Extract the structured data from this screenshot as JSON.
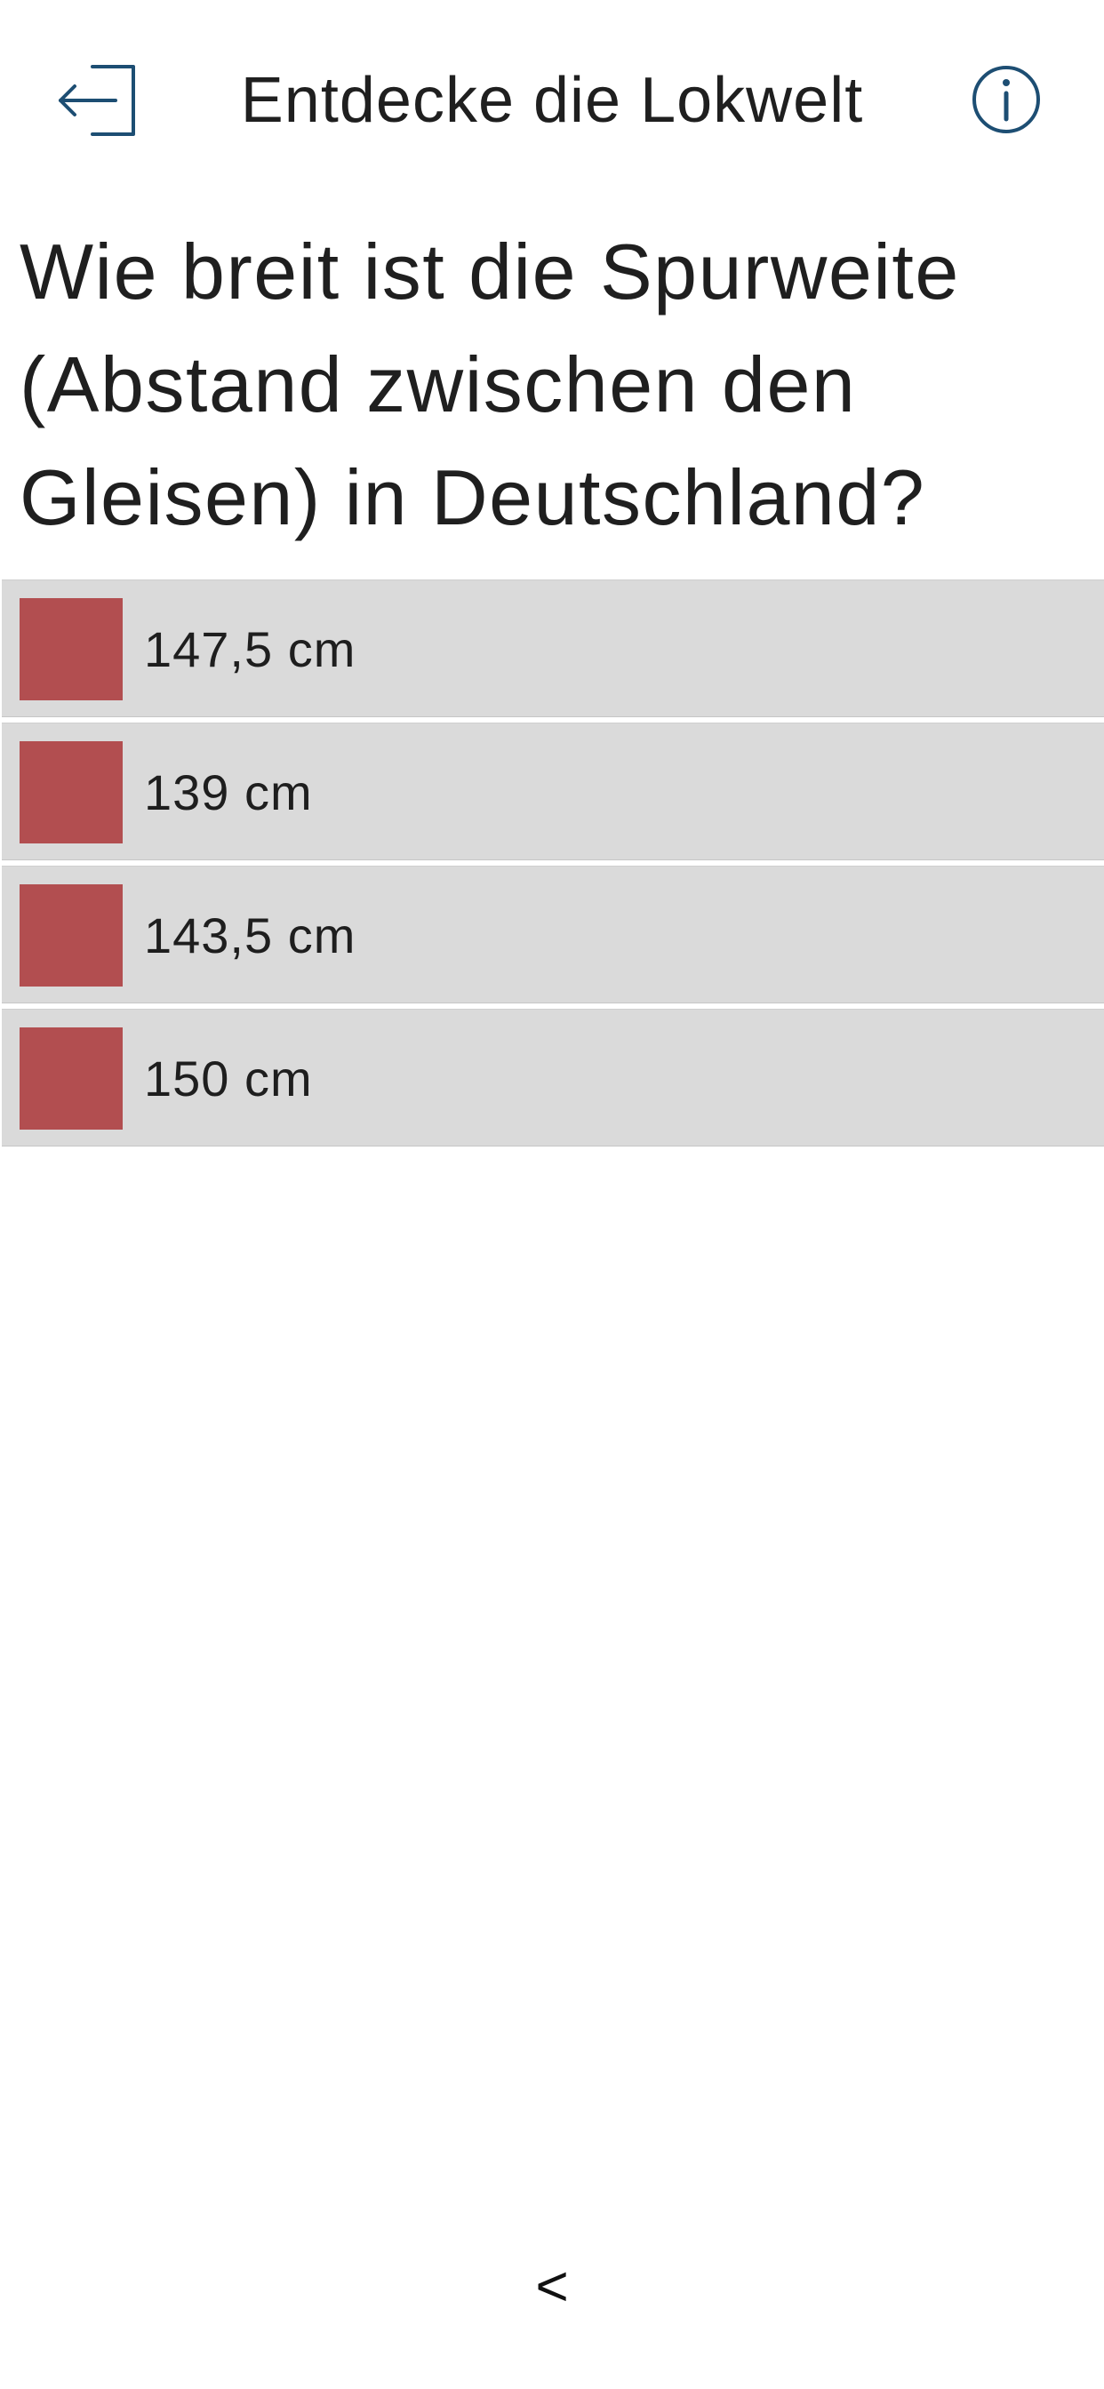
{
  "header": {
    "title": "Entdecke die Lokwelt",
    "exit_icon": "exit-icon",
    "info_icon": "info-icon",
    "icon_color": "#1d4e73"
  },
  "question": {
    "text": "Wie breit ist die Spurweite (Abstand zwischen den Gleisen) in Deutschland?"
  },
  "answers": [
    {
      "label": "147,5 cm"
    },
    {
      "label": "139 cm"
    },
    {
      "label": "143,5 cm"
    },
    {
      "label": "150 cm"
    }
  ],
  "colors": {
    "answer_background": "#dadada",
    "answer_marker": "#b24e50"
  },
  "footer": {
    "back_label": "<"
  }
}
